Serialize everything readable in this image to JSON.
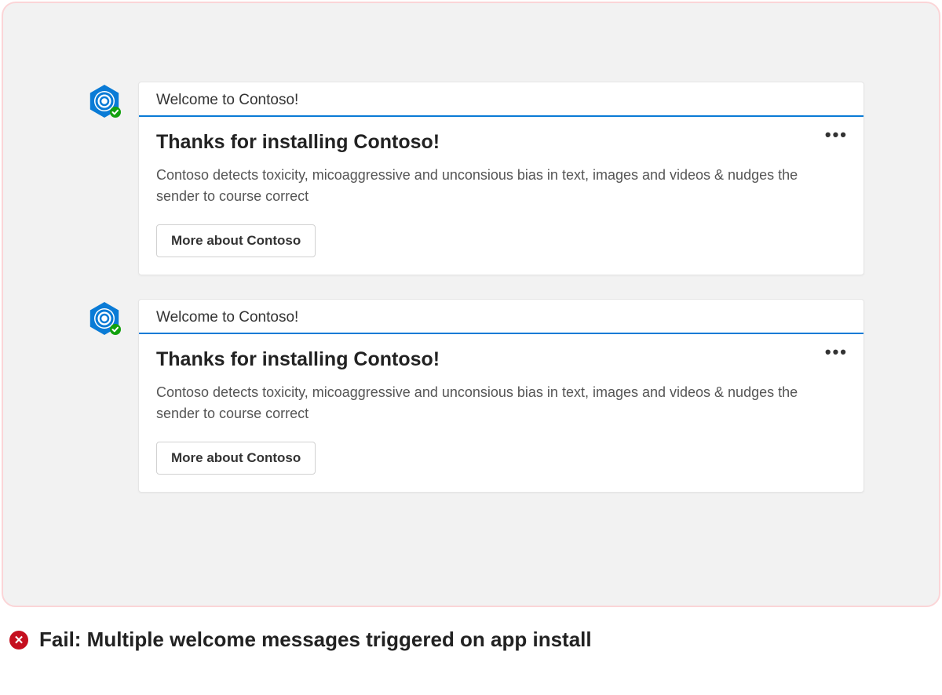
{
  "messages": [
    {
      "header": "Welcome to Contoso!",
      "title": "Thanks for installing Contoso!",
      "description": "Contoso detects toxicity, micoaggressive and unconsious bias in text, images and videos & nudges the sender to course correct",
      "button": "More about Contoso"
    },
    {
      "header": "Welcome to Contoso!",
      "title": "Thanks for installing Contoso!",
      "description": "Contoso detects toxicity, micoaggressive and unconsious bias in text, images and videos & nudges the sender to course correct",
      "button": "More about Contoso"
    }
  ],
  "result": {
    "label": "Fail: Multiple welcome messages triggered on app install",
    "icon_glyph": "✕"
  }
}
